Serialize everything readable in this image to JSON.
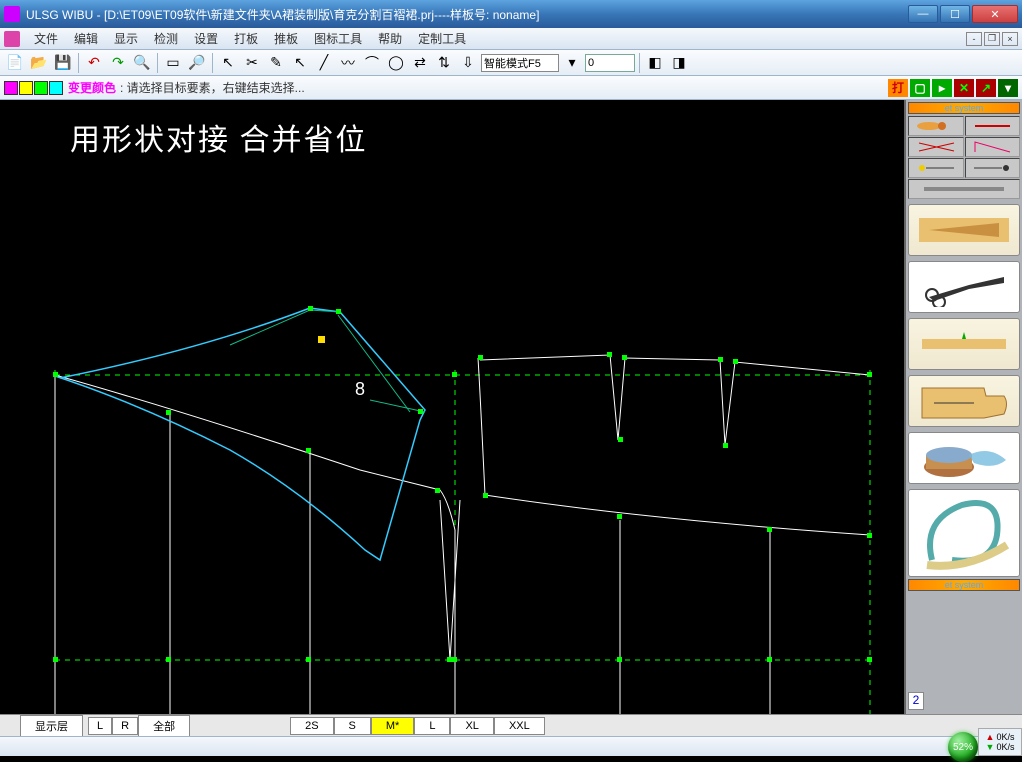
{
  "titlebar": {
    "title": "ULSG WIBU - [D:\\ET09\\ET09软件\\新建文件夹\\A裙装制版\\育克分割百褶裙.prj----样板号: noname]"
  },
  "menu": {
    "items": [
      "文件",
      "编辑",
      "显示",
      "检测",
      "设置",
      "打板",
      "推板",
      "图标工具",
      "帮助",
      "定制工具"
    ]
  },
  "toolbar1": {
    "mode_label": "智能模式F5",
    "num_value": "0"
  },
  "colorbar": {
    "change_label": "变更颜色",
    "hint": ": 请选择目标要素，右键结束选择...",
    "right_label": "打"
  },
  "canvas": {
    "overlay_text": "用形状对接    合并省位",
    "small_text": "8"
  },
  "rightpanel": {
    "header1": "et system",
    "footer": "et system",
    "number": "2"
  },
  "bottombar": {
    "layer_label": "显示层",
    "l": "L",
    "r": "R",
    "all": "全部",
    "sizes": [
      "2S",
      "S",
      "M*",
      "L",
      "XL",
      "XXL"
    ]
  },
  "status": {
    "ball_pct": "52%",
    "net_up": "0K/s",
    "net_down": "0K/s"
  }
}
